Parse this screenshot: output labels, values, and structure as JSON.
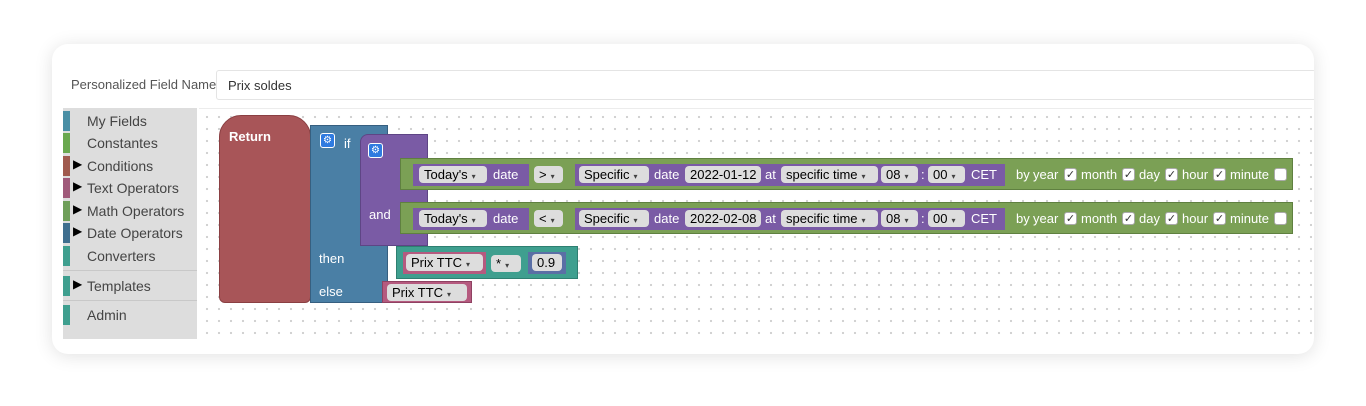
{
  "field": {
    "label": "Personalized Field Name",
    "value": "Prix soldes"
  },
  "toolbox": {
    "items": [
      {
        "label": "My Fields",
        "color": "#4a8fa5",
        "arrow": ""
      },
      {
        "label": "Constantes",
        "color": "#6aa84f",
        "arrow": ""
      },
      {
        "label": "Conditions",
        "color": "#a05a4e",
        "arrow": "▶"
      },
      {
        "label": "Text Operators",
        "color": "#a05a7a",
        "arrow": "▶"
      },
      {
        "label": "Math Operators",
        "color": "#6f9f5a",
        "arrow": "▶"
      },
      {
        "label": "Date Operators",
        "color": "#3f6f8f",
        "arrow": "▶"
      },
      {
        "label": "Converters",
        "color": "#3f9f8f",
        "arrow": ""
      },
      {
        "label": "Templates",
        "color": "#3f9f8f",
        "arrow": "▶"
      },
      {
        "label": "Admin",
        "color": "#3f9f8f",
        "arrow": ""
      }
    ]
  },
  "blocks": {
    "return_label": "Return",
    "if_label": "if",
    "and_label": "and",
    "then_label": "then",
    "else_label": "else",
    "cond1": {
      "today": "Today's",
      "date": "date",
      "op": ">",
      "specific": "Specific",
      "date2": "date",
      "dateval": "2022-01-12",
      "at": "at",
      "time_mode": "specific time",
      "hour": "08",
      "colon": ":",
      "minute": "00",
      "tz": "CET"
    },
    "cond2": {
      "today": "Today's",
      "date": "date",
      "op": "<",
      "specific": "Specific",
      "date2": "date",
      "dateval": "2022-02-08",
      "at": "at",
      "time_mode": "specific time",
      "hour": "08",
      "colon": ":",
      "minute": "00",
      "tz": "CET"
    },
    "byline": {
      "by": "by",
      "year": "year",
      "month": "month",
      "day": "day",
      "hour": "hour",
      "minute": "minute",
      "checked": "✓"
    },
    "then_expr": {
      "field": "Prix TTC",
      "op": "*",
      "number": "0.9"
    },
    "else_expr": {
      "field": "Prix TTC"
    },
    "gear": "⚙",
    "dropdown": "▾"
  },
  "colors": {
    "return": "#a85558",
    "if": "#4a7fa5",
    "and": "#7a5ba5",
    "date_op": "#7ba055",
    "date_block": "#7a5ba5",
    "math": "#3f9f8f",
    "text_field": "#b55a7f"
  }
}
